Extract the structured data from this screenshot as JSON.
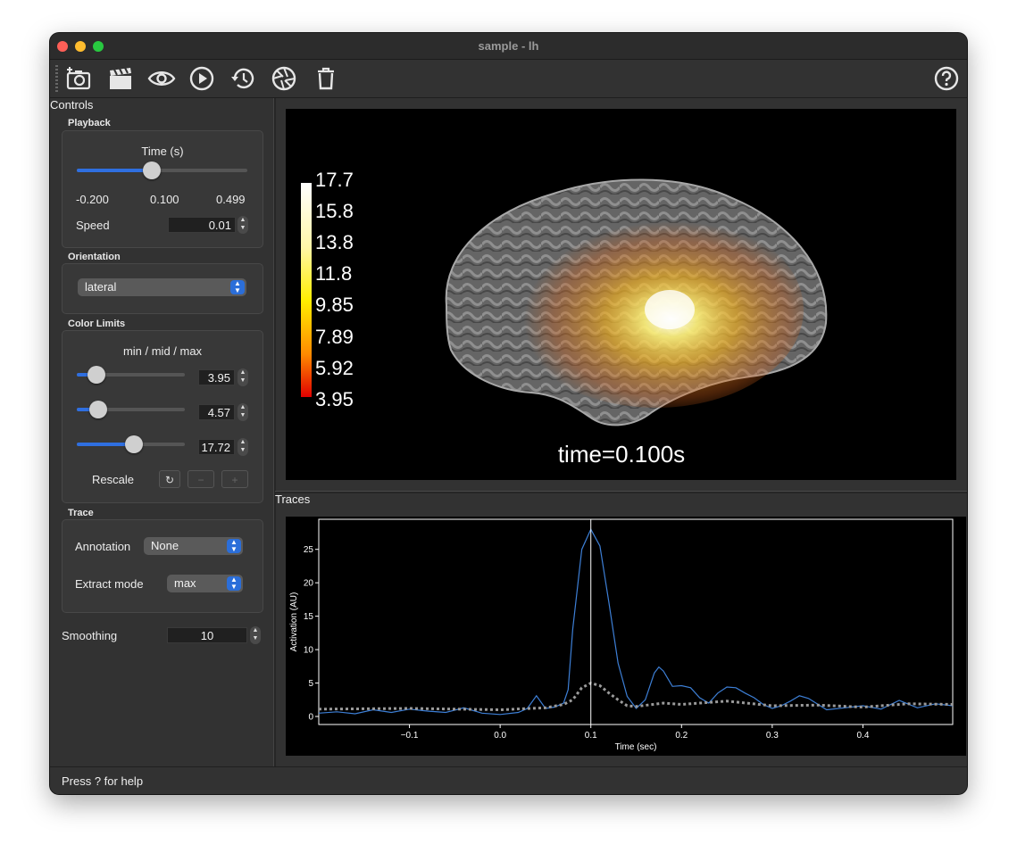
{
  "window": {
    "title": "sample - lh"
  },
  "toolbar": {
    "buttons": [
      {
        "name": "screenshot",
        "icon": "camera-plus-icon"
      },
      {
        "name": "movie",
        "icon": "clapperboard-icon"
      },
      {
        "name": "toggle-interface",
        "icon": "eye-icon"
      },
      {
        "name": "play",
        "icon": "play-circle-icon"
      },
      {
        "name": "restore",
        "icon": "history-icon"
      },
      {
        "name": "reset-camera",
        "icon": "aperture-icon"
      },
      {
        "name": "clear",
        "icon": "trash-icon"
      },
      {
        "name": "help",
        "icon": "question-circle-icon"
      }
    ]
  },
  "controls": {
    "title": "Controls",
    "playback": {
      "title": "Playback",
      "time_label": "Time (s)",
      "time_value_fraction": 0.43,
      "min": "-0.200",
      "current": "0.100",
      "max": "0.499",
      "speed_label": "Speed",
      "speed_value": "0.01"
    },
    "orientation": {
      "title": "Orientation",
      "value": "lateral"
    },
    "color_limits": {
      "title": "Color Limits",
      "label": "min / mid / max",
      "min_value": "3.95",
      "mid_value": "4.57",
      "max_value": "17.72",
      "min_fraction": 0.12,
      "mid_fraction": 0.14,
      "max_fraction": 0.53,
      "rescale_label": "Rescale"
    },
    "trace": {
      "title": "Trace",
      "annotation_label": "Annotation",
      "annotation_value": "None",
      "extract_label": "Extract mode",
      "extract_value": "max"
    },
    "smoothing": {
      "label": "Smoothing",
      "value": "10"
    }
  },
  "viewer": {
    "colorbar_ticks": [
      "17.7",
      "15.8",
      "13.8",
      "11.8",
      "9.85",
      "7.89",
      "5.92",
      "3.95"
    ],
    "time_text": "time=0.100s"
  },
  "traces": {
    "title": "Traces",
    "chart_data": {
      "type": "line",
      "xlabel": "Time (sec)",
      "ylabel": "Activation (AU)",
      "xlim": [
        -0.2,
        0.499
      ],
      "ylim": [
        -1.2,
        29.5
      ],
      "xticks": [
        -0.1,
        0.0,
        0.1,
        0.2,
        0.3,
        0.4
      ],
      "xtick_labels": [
        "−0.1",
        "0.0",
        "0.1",
        "0.2",
        "0.3",
        "0.4"
      ],
      "yticks": [
        0,
        5,
        10,
        15,
        20,
        25
      ],
      "current_time": 0.1,
      "series": [
        {
          "style": "solid",
          "color": "#3d7fd6",
          "x": [
            -0.2,
            -0.18,
            -0.16,
            -0.14,
            -0.12,
            -0.1,
            -0.08,
            -0.06,
            -0.04,
            -0.02,
            0.0,
            0.02,
            0.03,
            0.04,
            0.05,
            0.06,
            0.07,
            0.075,
            0.08,
            0.09,
            0.1,
            0.11,
            0.12,
            0.13,
            0.14,
            0.15,
            0.16,
            0.17,
            0.175,
            0.18,
            0.19,
            0.2,
            0.21,
            0.22,
            0.23,
            0.24,
            0.25,
            0.26,
            0.27,
            0.28,
            0.29,
            0.3,
            0.31,
            0.32,
            0.33,
            0.34,
            0.36,
            0.38,
            0.4,
            0.42,
            0.44,
            0.46,
            0.48,
            0.499
          ],
          "y": [
            0.5,
            0.7,
            0.4,
            1.0,
            0.6,
            1.1,
            0.8,
            0.6,
            1.3,
            0.5,
            0.3,
            0.6,
            1.2,
            3.1,
            1.2,
            1.4,
            2.0,
            4.0,
            13.0,
            25.0,
            28.0,
            25.5,
            17.0,
            8.0,
            3.0,
            1.2,
            2.5,
            6.5,
            7.4,
            6.8,
            4.5,
            4.6,
            4.3,
            2.8,
            2.0,
            3.5,
            4.4,
            4.3,
            3.5,
            2.8,
            1.8,
            1.2,
            1.6,
            2.3,
            3.1,
            2.7,
            1.0,
            1.3,
            1.6,
            1.1,
            2.4,
            1.3,
            1.9,
            1.6
          ]
        },
        {
          "style": "dotted",
          "color": "#9a9a9a",
          "x": [
            -0.2,
            -0.1,
            0.0,
            0.05,
            0.07,
            0.08,
            0.09,
            0.1,
            0.11,
            0.12,
            0.13,
            0.14,
            0.15,
            0.18,
            0.2,
            0.25,
            0.3,
            0.35,
            0.4,
            0.45,
            0.499
          ],
          "y": [
            1.1,
            1.2,
            1.0,
            1.3,
            1.8,
            2.5,
            4.3,
            5.0,
            4.6,
            3.5,
            2.5,
            1.6,
            1.5,
            2.0,
            1.8,
            2.3,
            1.6,
            1.7,
            1.4,
            1.9,
            1.8
          ]
        }
      ]
    }
  },
  "status": {
    "text": "Press ? for help"
  }
}
